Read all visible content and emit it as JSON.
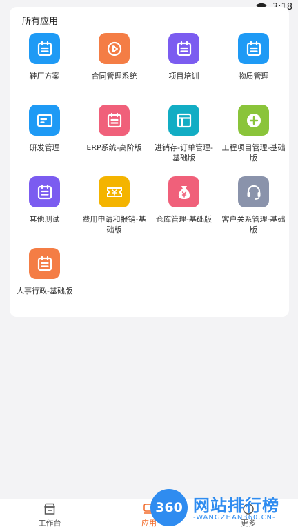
{
  "status_bar": {
    "time": "3:18",
    "wifi_icon": "wifi-icon"
  },
  "card": {
    "title": "所有应用"
  },
  "apps": [
    {
      "label": "鞋厂方案",
      "icon": "calendar-icon",
      "color": "#1e9af5"
    },
    {
      "label": "合同管理系统",
      "icon": "play-icon",
      "color": "#f47d45"
    },
    {
      "label": "项目培训",
      "icon": "calendar-icon",
      "color": "#7b5cf0"
    },
    {
      "label": "物质管理",
      "icon": "calendar-icon",
      "color": "#1e9af5"
    },
    {
      "label": "研发管理",
      "icon": "display-icon",
      "color": "#1e9af5"
    },
    {
      "label": "ERP系统-高阶版",
      "icon": "calendar-icon",
      "color": "#f0607a"
    },
    {
      "label": "进销存-订单管理-基础版",
      "icon": "layout-icon",
      "color": "#12adc4"
    },
    {
      "label": "工程项目管理-基础版",
      "icon": "plus-circle-icon",
      "color": "#8ac43a"
    },
    {
      "label": "其他测试",
      "icon": "calendar-icon",
      "color": "#7b5cf0"
    },
    {
      "label": "费用申请和报销-基础版",
      "icon": "ticket-icon",
      "color": "#f4b400"
    },
    {
      "label": "仓库管理-基础版",
      "icon": "money-bag-icon",
      "color": "#f0607a"
    },
    {
      "label": "客户关系管理-基础版",
      "icon": "headset-icon",
      "color": "#8a93ab"
    },
    {
      "label": "人事行政-基础版",
      "icon": "calendar-icon",
      "color": "#f47d45"
    }
  ],
  "tabbar": {
    "tabs": [
      {
        "label": "工作台",
        "icon": "workbench-icon"
      },
      {
        "label": "应用",
        "icon": "apps-icon",
        "active": true
      },
      {
        "label": "更多",
        "icon": "more-icon"
      }
    ],
    "accent": "#f26b2a"
  },
  "watermark": {
    "badge": "360",
    "title": "网站排行榜",
    "subtitle": "-WANGZHAN360.CN-"
  }
}
